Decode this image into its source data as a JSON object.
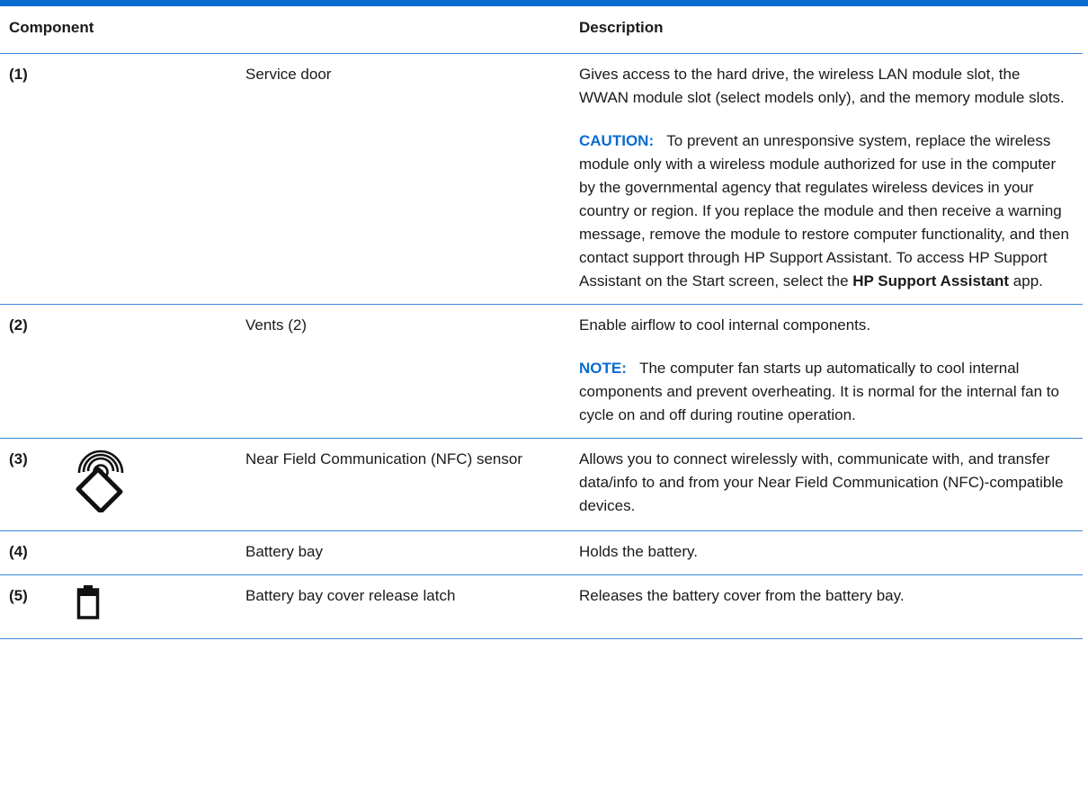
{
  "table": {
    "headers": {
      "component": "Component",
      "description": "Description"
    },
    "rows": [
      {
        "num": "(1)",
        "icon": "",
        "name": "Service door",
        "desc1": "Gives access to the hard drive, the wireless LAN module slot, the WWAN module slot (select models only), and the memory module slots.",
        "note_label": "CAUTION:",
        "note_text_a": "To prevent an unresponsive system, replace the wireless module only with a wireless module authorized for use in the computer by the governmental agency that regulates wireless devices in your country or region. If you replace the module and then receive a warning message, remove the module to restore computer functionality, and then contact support through HP Support Assistant. To access HP Support Assistant on the Start screen, select the ",
        "note_bold": "HP Support Assistant",
        "note_text_b": " app."
      },
      {
        "num": "(2)",
        "icon": "",
        "name": "Vents (2)",
        "desc1": "Enable airflow to cool internal components.",
        "note_label": "NOTE:",
        "note_text_a": "The computer fan starts up automatically to cool internal components and prevent overheating. It is normal for the internal fan to cycle on and off during routine operation."
      },
      {
        "num": "(3)",
        "icon": "nfc-icon",
        "name": "Near Field Communication (NFC) sensor",
        "desc1": "Allows you to connect wirelessly with, communicate with, and transfer data/info to and from your Near Field Communication (NFC)-compatible devices."
      },
      {
        "num": "(4)",
        "icon": "",
        "name": "Battery bay",
        "desc1": "Holds the battery."
      },
      {
        "num": "(5)",
        "icon": "battery-icon",
        "name": "Battery bay cover release latch",
        "desc1": "Releases the battery cover from the battery bay."
      }
    ]
  },
  "colors": {
    "accent": "#0a6bd1",
    "rule": "#3a87d8"
  }
}
